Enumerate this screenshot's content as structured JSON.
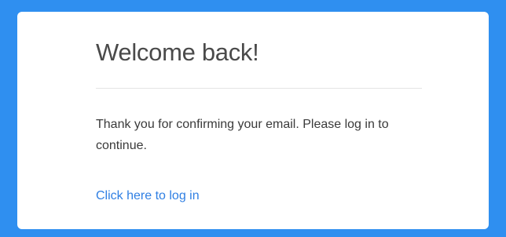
{
  "card": {
    "title": "Welcome back!",
    "message": "Thank you for confirming your email. Please log in to continue.",
    "login_link_label": "Click here to log in"
  },
  "colors": {
    "background": "#2f8ff0",
    "card": "#ffffff",
    "link": "#2f7fe3"
  }
}
